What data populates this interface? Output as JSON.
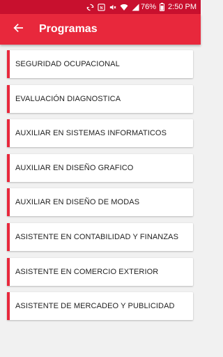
{
  "status_bar": {
    "battery_percent": "76%",
    "time": "2:50 PM",
    "icons": [
      "sync-icon",
      "nfc-icon",
      "mute-icon",
      "wifi-icon",
      "signal-icon",
      "battery-icon"
    ]
  },
  "app_bar": {
    "back_icon": "arrow-left-icon",
    "title": "Programas"
  },
  "programs": [
    "SEGURIDAD OCUPACIONAL",
    "EVALUACIÓN DIAGNOSTICA",
    "AUXILIAR EN SISTEMAS INFORMATICOS",
    "AUXILIAR EN DISEÑO GRAFICO",
    "AUXILIAR EN DISEÑO DE MODAS",
    "ASISTENTE EN CONTABILIDAD Y FINANZAS",
    "ASISTENTE EN COMERCIO EXTERIOR",
    "ASISTENTE DE MERCADEO Y PUBLICIDAD"
  ],
  "colors": {
    "status_bar": "#c8102e",
    "app_bar": "#e8283c",
    "accent": "#e8283c",
    "background": "#f1f1f1",
    "card": "#ffffff"
  }
}
